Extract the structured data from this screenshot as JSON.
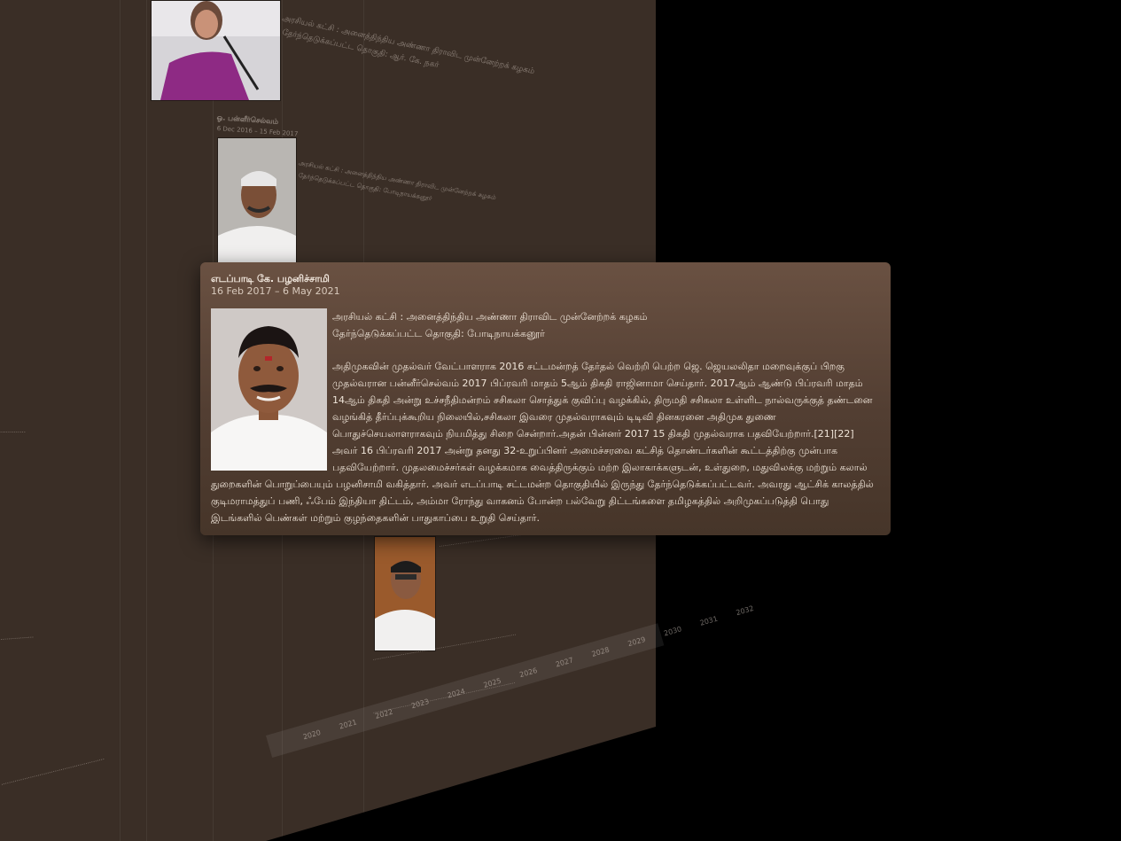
{
  "active_card": {
    "name": "எடப்பாடி கே. பழனிச்சாமி",
    "dates": "16 Feb 2017 – 6 May 2021",
    "party": "அரசியல் கட்சி : அனைத்திந்திய அண்ணா திராவிட முன்னேற்றக் கழகம்",
    "constituency": "தேர்ந்தெடுக்கப்பட்ட தொகுதி: போடிநாயக்கனூர்",
    "bio": "அதிமுகவின் முதல்வர் வேட்பாளராக 2016 சட்டமன்றத் தேர்தல் வெற்றி பெற்ற ஜெ. ஜெயலலிதா மறைவுக்குப் பிறகு முதல்வரான பன்னீர்செல்வம் 2017 பிப்ரவரி மாதம் 5ஆம் திகதி ராஜினாமா செய்தார். 2017ஆம் ஆண்டு பிப்ரவரி மாதம் 14ஆம் திகதி அன்று உச்சநீதிமன்றம் சசிகலா சொத்துக் குவிப்பு வழக்கில், திருமதி சசிகலா உள்ளிட நால்வருக்குத் தண்டனை வழங்கித் தீர்ப்புக்கூறிய நிலையில்,சசிகலா இவரை முதல்வராகவும் டிடிவி தினகரனை அதிமுக துணை பொதுச்செயலாளராகவும் நியமித்து சிறை சென்றார்.அதன் பின்னர் 2017 15 திகதி முதல்வராக பதவியேற்றார்.[21][22] அவர் 16 பிப்ரவரி 2017 அன்று தனது 32-உறுப்பினர் அமைச்சரவை கட்சித் தொண்டர்களின் கூட்டத்திற்கு முன்பாக பதவியேற்றார். முதலமைச்சர்கள் வழக்கமாக வைத்திருக்கும் மற்ற இலாகாக்களுடன், உள்துறை, மதுவிலக்கு மற்றும் கலால் துறைகளின் பொறுப்பையும் பழனிசாமி வகித்தார். அவர் எடப்பாடி சட்டமன்ற தொகுதியில் இருந்து தேர்ந்தெடுக்கப்பட்டவர். அவரது ஆட்சிக் காலத்தில் குடிமராமத்துப் பணி, ஃபேம் இந்தியா திட்டம், அம்மா ரோந்து வாகனம் போன்ற பல்வேறு திட்டங்களை தமிழகத்தில் அறிமுகப்படுத்தி பொது இடங்களில் பெண்கள் மற்றும் குழந்தைகளின் பாதுகாப்பை உறுதி செய்தார்."
  },
  "background_cards": {
    "card_top": {
      "line1": "அரசியல் கட்சி : அனைத்திந்திய அண்ணா திராவிட முன்னேற்றக் கழகம்",
      "line2": "தேர்ந்தெடுக்கப்பட்ட தொகுதி: ஆர். கே. நகர்"
    },
    "card_ops": {
      "name": "ஓ. பன்னீர்செல்வம்",
      "dates": "6 Dec 2016 – 15 Feb 2017",
      "line1": "அரசியல் கட்சி : அனைத்திந்திய அண்ணா திராவிட முன்னேற்றக் கழகம்",
      "line2": "தேர்ந்தெடுக்கப்பட்ட தொகுதி: போடிநாயக்கனூர்"
    }
  },
  "timeline_years": [
    "2020",
    "2021",
    "2022",
    "2023",
    "2024",
    "2025",
    "2026",
    "2027",
    "2028",
    "2029",
    "2030",
    "2031",
    "2032"
  ],
  "colors": {
    "background": "#000000",
    "wall": "#3a2e26",
    "card_top": "#6a5142",
    "card_bottom": "#463529"
  }
}
